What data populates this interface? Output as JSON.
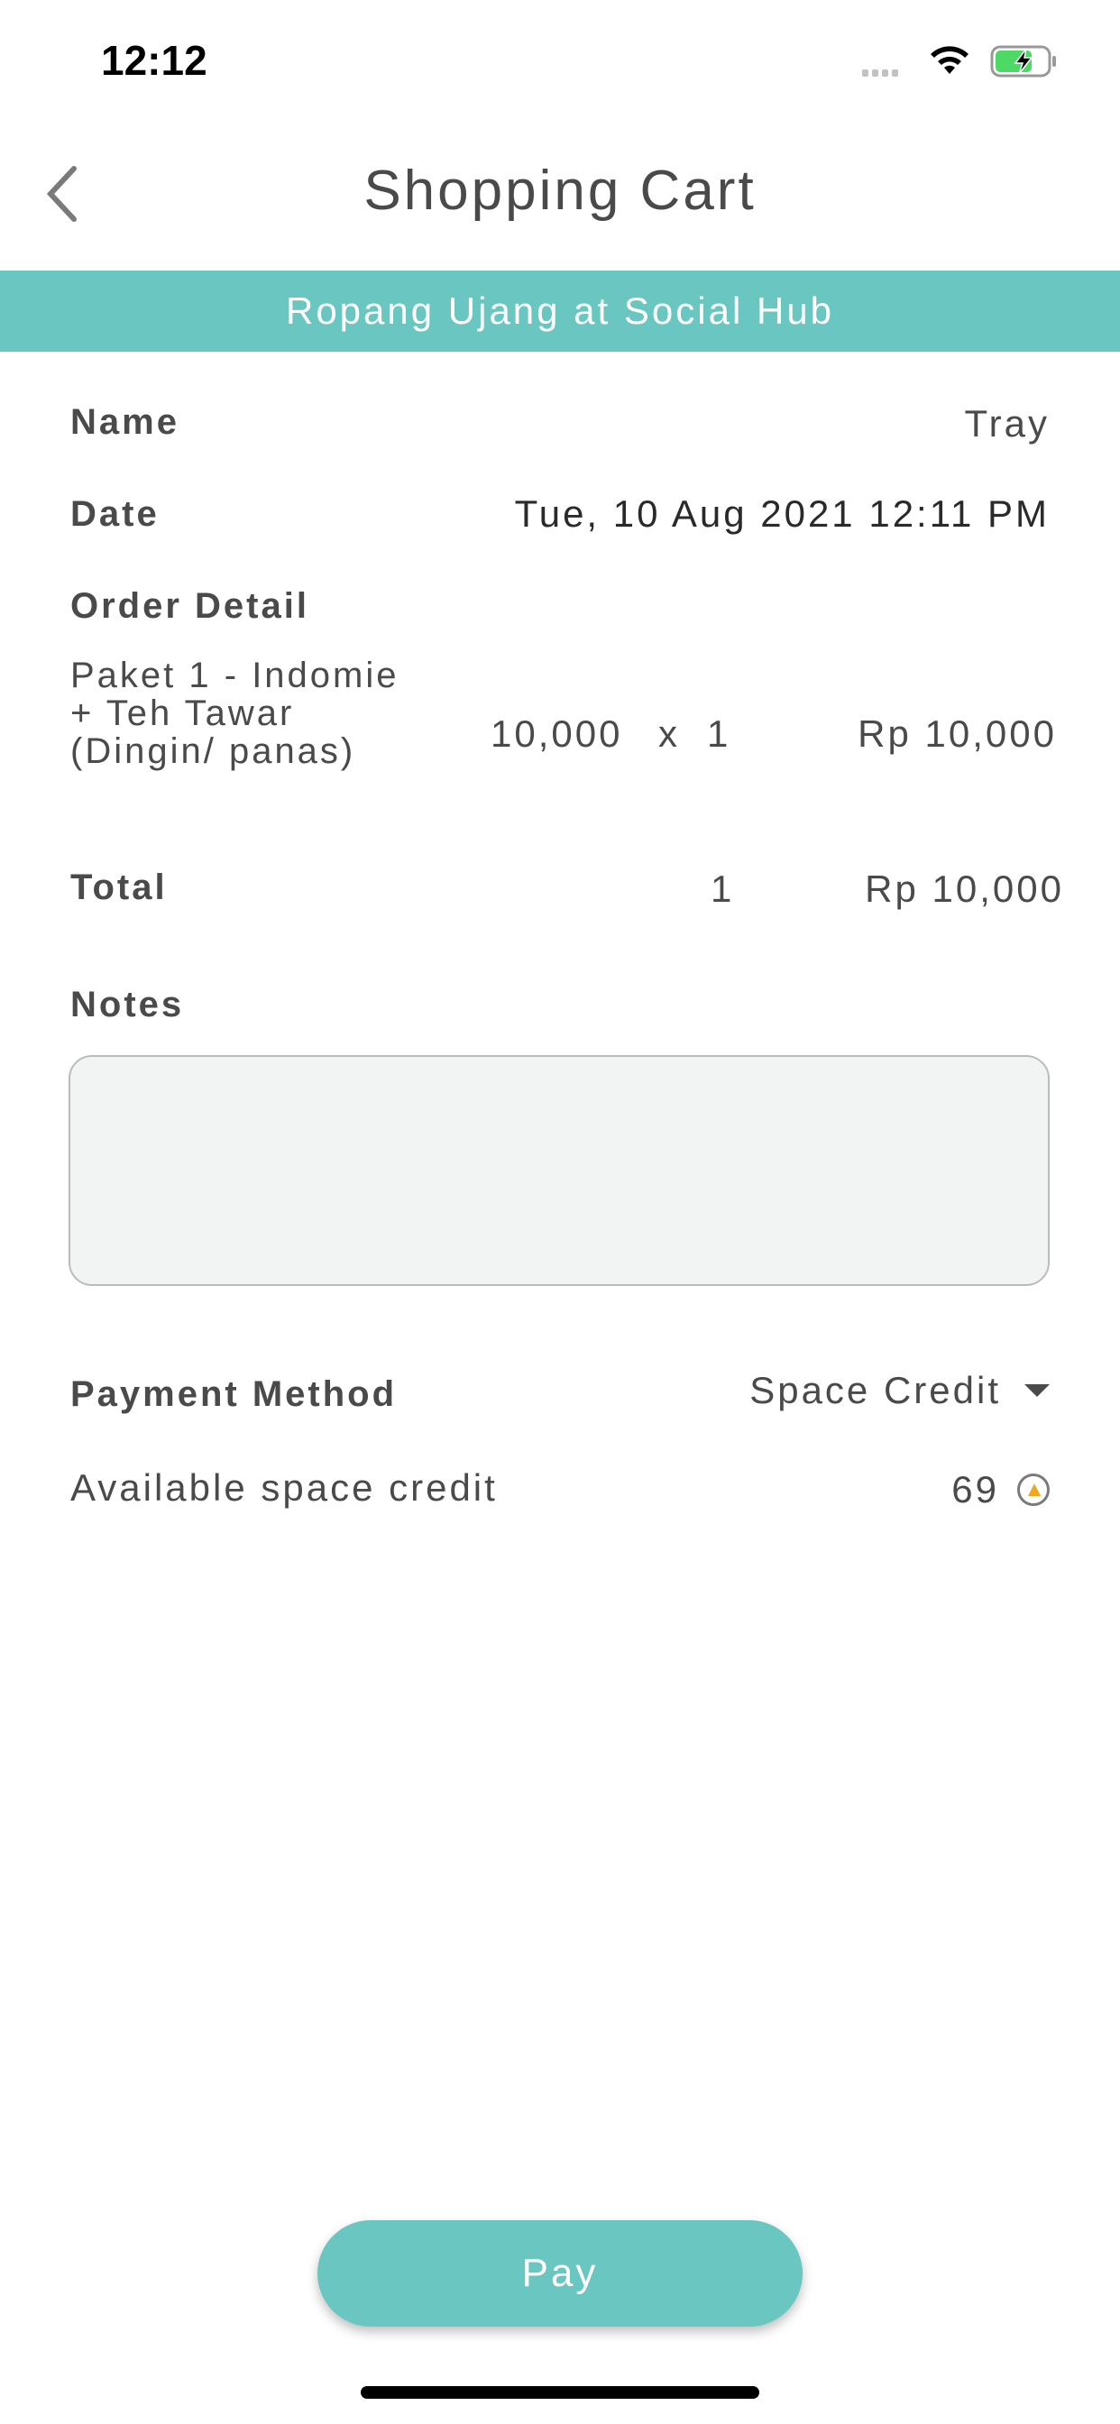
{
  "status_bar": {
    "time": "12:12"
  },
  "header": {
    "title": "Shopping Cart"
  },
  "banner": {
    "text": "Ropang Ujang at Social Hub"
  },
  "order": {
    "name_label": "Name",
    "name_value": "Tray",
    "date_label": "Date",
    "date_value": "Tue, 10 Aug 2021 12:11 PM",
    "detail_label": "Order Detail",
    "items": [
      {
        "name": "Paket 1 - Indomie + Teh Tawar (Dingin/ panas)",
        "price": "10,000",
        "x": "x",
        "qty": "1",
        "subtotal": "Rp 10,000"
      }
    ],
    "total_label": "Total",
    "total_qty": "1",
    "total_amount": "Rp 10,000"
  },
  "notes": {
    "label": "Notes",
    "value": ""
  },
  "payment": {
    "label": "Payment Method",
    "selected": "Space Credit",
    "credit_label": "Available space credit",
    "credit_value": "69"
  },
  "pay_button": {
    "label": "Pay"
  },
  "colors": {
    "accent": "#69c6c1",
    "text": "#4a4a4a",
    "notes_bg": "#f1f4f3"
  }
}
